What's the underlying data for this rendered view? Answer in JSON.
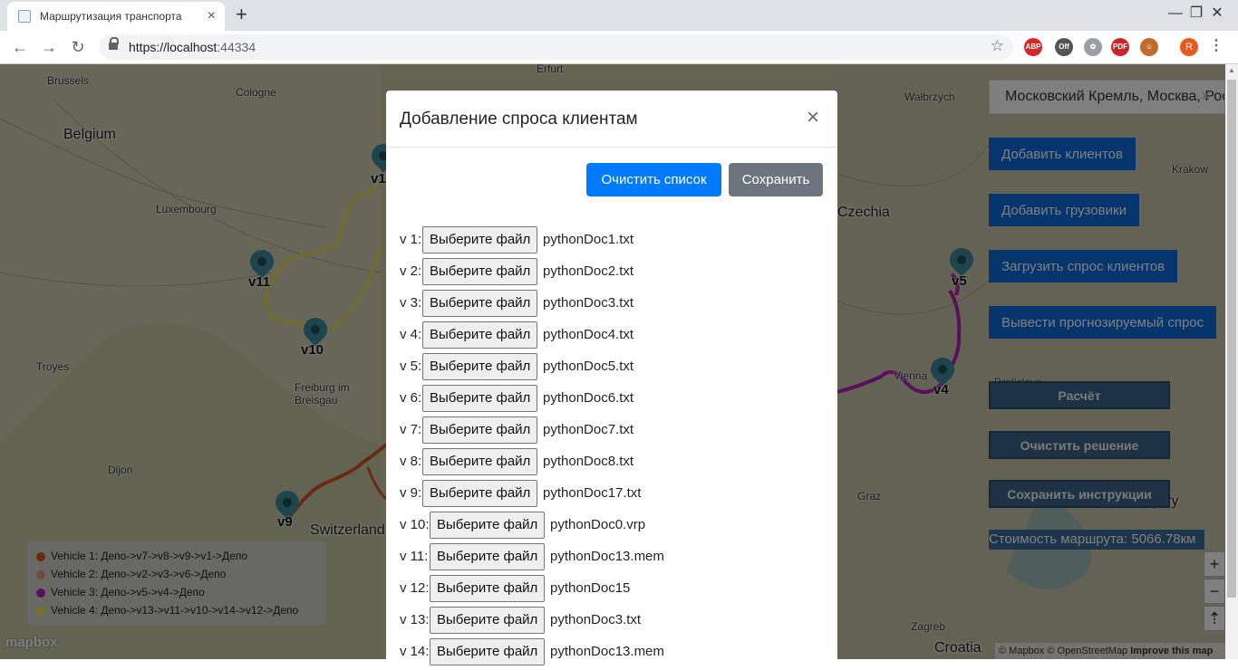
{
  "browser": {
    "tab_title": "Маршрутизация транспорта",
    "tab_close": "×",
    "new_tab": "+",
    "url_host": "https://localhost",
    "url_port": ":44334",
    "minimize": "—",
    "restore": "❐",
    "close": "✕",
    "extensions": [
      {
        "name": "adblock-plus-icon",
        "text": "ABP",
        "color": "#d8252a"
      },
      {
        "name": "off-extension-icon",
        "text": "Off",
        "color": "#555555"
      },
      {
        "name": "paw-extension-icon",
        "text": "✿",
        "color": "#9aa0a6"
      },
      {
        "name": "pdf-extension-icon",
        "text": "PDF",
        "color": "#c62828"
      },
      {
        "name": "monkey-extension-icon",
        "text": "☺",
        "color": "#c06a2b"
      }
    ],
    "profile_initial": "R"
  },
  "map": {
    "cities": [
      {
        "name": "Brussels"
      },
      {
        "name": "Cologne"
      },
      {
        "name": "Erfurt"
      },
      {
        "name": "Luxembourg"
      },
      {
        "name": "Troyes"
      },
      {
        "name": "Freiburg im\nBreisgau"
      },
      {
        "name": "Dijon"
      },
      {
        "name": "Wałbrzych"
      },
      {
        "name": "Krakow"
      },
      {
        "name": "Vienna"
      },
      {
        "name": "Graz"
      },
      {
        "name": "Zagreb"
      },
      {
        "name": "Bratislava"
      }
    ],
    "countries": [
      "Belgium",
      "Czechia",
      "Switzerland",
      "Hungary",
      "Croatia"
    ],
    "markers": [
      "v1",
      "v11",
      "v10",
      "v5",
      "v4",
      "v9"
    ],
    "legend": [
      {
        "text": "Vehicle 1: Депо->v7->v8->v9->v1->Депо",
        "color": "#d2541e"
      },
      {
        "text": "Vehicle 2: Депо->v2->v3->v6->Депо",
        "color": "#d99a7a"
      },
      {
        "text": "Vehicle 3: Депо->v5->v4->Депо",
        "color": "#b01fb8"
      },
      {
        "text": "Vehicle 4: Депо->v13->v11->v10->v14->v12->Депо",
        "color": "#e8df58"
      }
    ],
    "logo": "mapbox",
    "attribution_mapbox": "© Mapbox",
    "attribution_osm": "© OpenStreetMap",
    "attribution_improve": "Improve this map",
    "zoom_in": "+",
    "zoom_out": "−",
    "compass": "⇡"
  },
  "controls": {
    "search_value": "Московский Кремль, Москва, Россия",
    "search_clear": "×",
    "add_clients": "Добавить клиентов",
    "add_trucks": "Добавить грузовики",
    "load_demand": "Загрузить спрос клиентов",
    "predict_demand": "Вывести прогнозируемый спрос",
    "calculate": "Расчёт",
    "clear_solution": "Очистить решение",
    "save_instructions": "Сохранить инструкции",
    "route_cost": "Стоимость маршрута: 5066.78км"
  },
  "modal": {
    "title": "Добавление спроса клиентам",
    "close": "×",
    "clear_list": "Очистить список",
    "save": "Сохранить",
    "choose_file": "Выберите файл",
    "rows": [
      {
        "label": "v 1:",
        "file": "pythonDoc1.txt"
      },
      {
        "label": "v 2:",
        "file": "pythonDoc2.txt"
      },
      {
        "label": "v 3:",
        "file": "pythonDoc3.txt"
      },
      {
        "label": "v 4:",
        "file": "pythonDoc4.txt"
      },
      {
        "label": "v 5:",
        "file": "pythonDoc5.txt"
      },
      {
        "label": "v 6:",
        "file": "pythonDoc6.txt"
      },
      {
        "label": "v 7:",
        "file": "pythonDoc7.txt"
      },
      {
        "label": "v 8:",
        "file": "pythonDoc8.txt"
      },
      {
        "label": "v 9:",
        "file": "pythonDoc17.txt"
      },
      {
        "label": "v 10:",
        "file": "pythonDoc0.vrp"
      },
      {
        "label": "v 11:",
        "file": "pythonDoc13.mem"
      },
      {
        "label": "v 12:",
        "file": "pythonDoc15"
      },
      {
        "label": "v 13:",
        "file": "pythonDoc3.txt"
      },
      {
        "label": "v 14:",
        "file": "pythonDoc13.mem"
      }
    ]
  }
}
